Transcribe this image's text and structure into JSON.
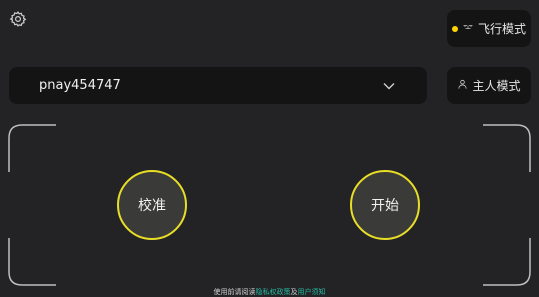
{
  "header": {
    "settings_icon": "gear-icon"
  },
  "mode_buttons": {
    "fly_mode": {
      "label": "飞行模式",
      "icon": "drone-icon",
      "indicator_color": "#ffd400"
    },
    "host_mode": {
      "label": "主人模式",
      "icon": "person-icon"
    }
  },
  "device_select": {
    "value": "pnay454747",
    "icon": "chevron-down-icon"
  },
  "controls": {
    "calibrate_label": "校准",
    "start_label": "开始",
    "ring_color": "#e8de27"
  },
  "footer": {
    "prefix": "使用前请阅读",
    "privacy_link": "隐私权政策",
    "joiner": "及",
    "terms_link": "用户须知",
    "link_color": "#28b8a0"
  }
}
